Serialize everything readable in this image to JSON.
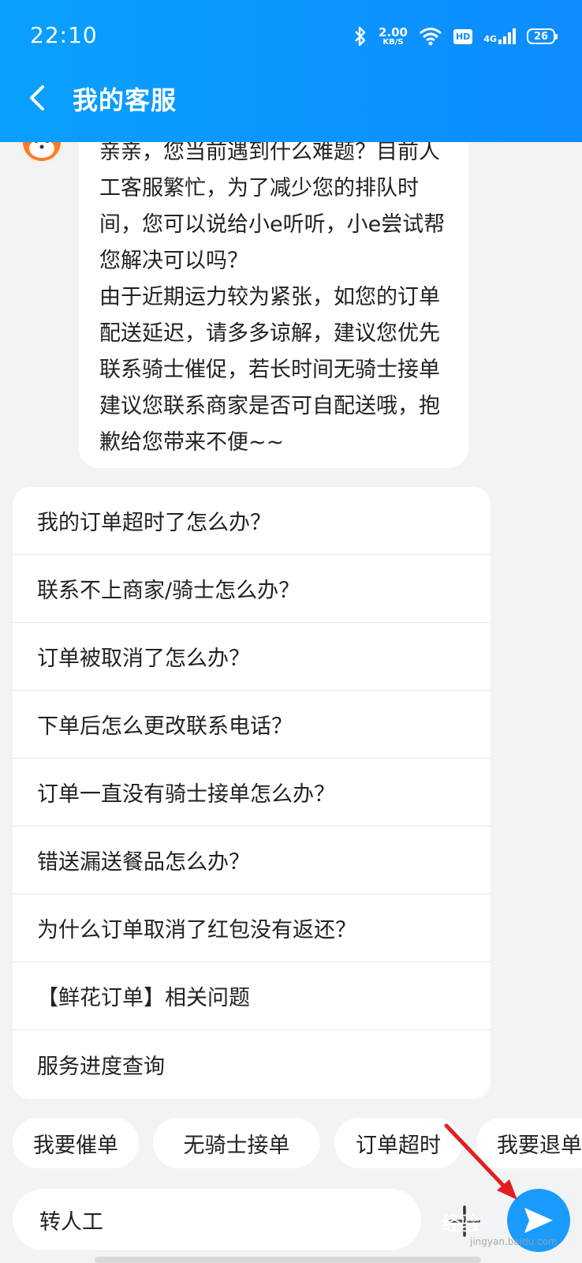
{
  "status_bar": {
    "time": "22:10",
    "speed_value": "2.00",
    "speed_unit": "KB/S",
    "hd": "HD",
    "network": "4G",
    "battery": "26"
  },
  "header": {
    "title": "我的客服"
  },
  "message": {
    "text": "亲亲，您当前遇到什么难题？目前人工客服繁忙，为了减少您的排队时间，您可以说给小e听听，小e尝试帮您解决可以吗？\n由于近期运力较为紧张，如您的订单配送延迟，请多多谅解，建议您优先联系骑士催促，若长时间无骑士接单建议您联系商家是否可自配送哦，抱歉给您带来不便~~"
  },
  "faq": [
    "我的订单超时了怎么办？",
    "联系不上商家/骑士怎么办？",
    "订单被取消了怎么办？",
    "下单后怎么更改联系电话？",
    "订单一直没有骑士接单怎么办？",
    "错送漏送餐品怎么办？",
    "为什么订单取消了红包没有返还？",
    "【鲜花订单】相关问题",
    "服务进度查询"
  ],
  "quick_replies": [
    "我要催单",
    "无骑士接单",
    "订单超时",
    "我要退单"
  ],
  "input": {
    "value": "转人工"
  },
  "watermark": {
    "text": "经验",
    "sub": "jingyan.baidu.com"
  },
  "colors": {
    "brand": "#0d8cff",
    "send": "#1a9bff",
    "annotation_arrow": "#e02020"
  }
}
